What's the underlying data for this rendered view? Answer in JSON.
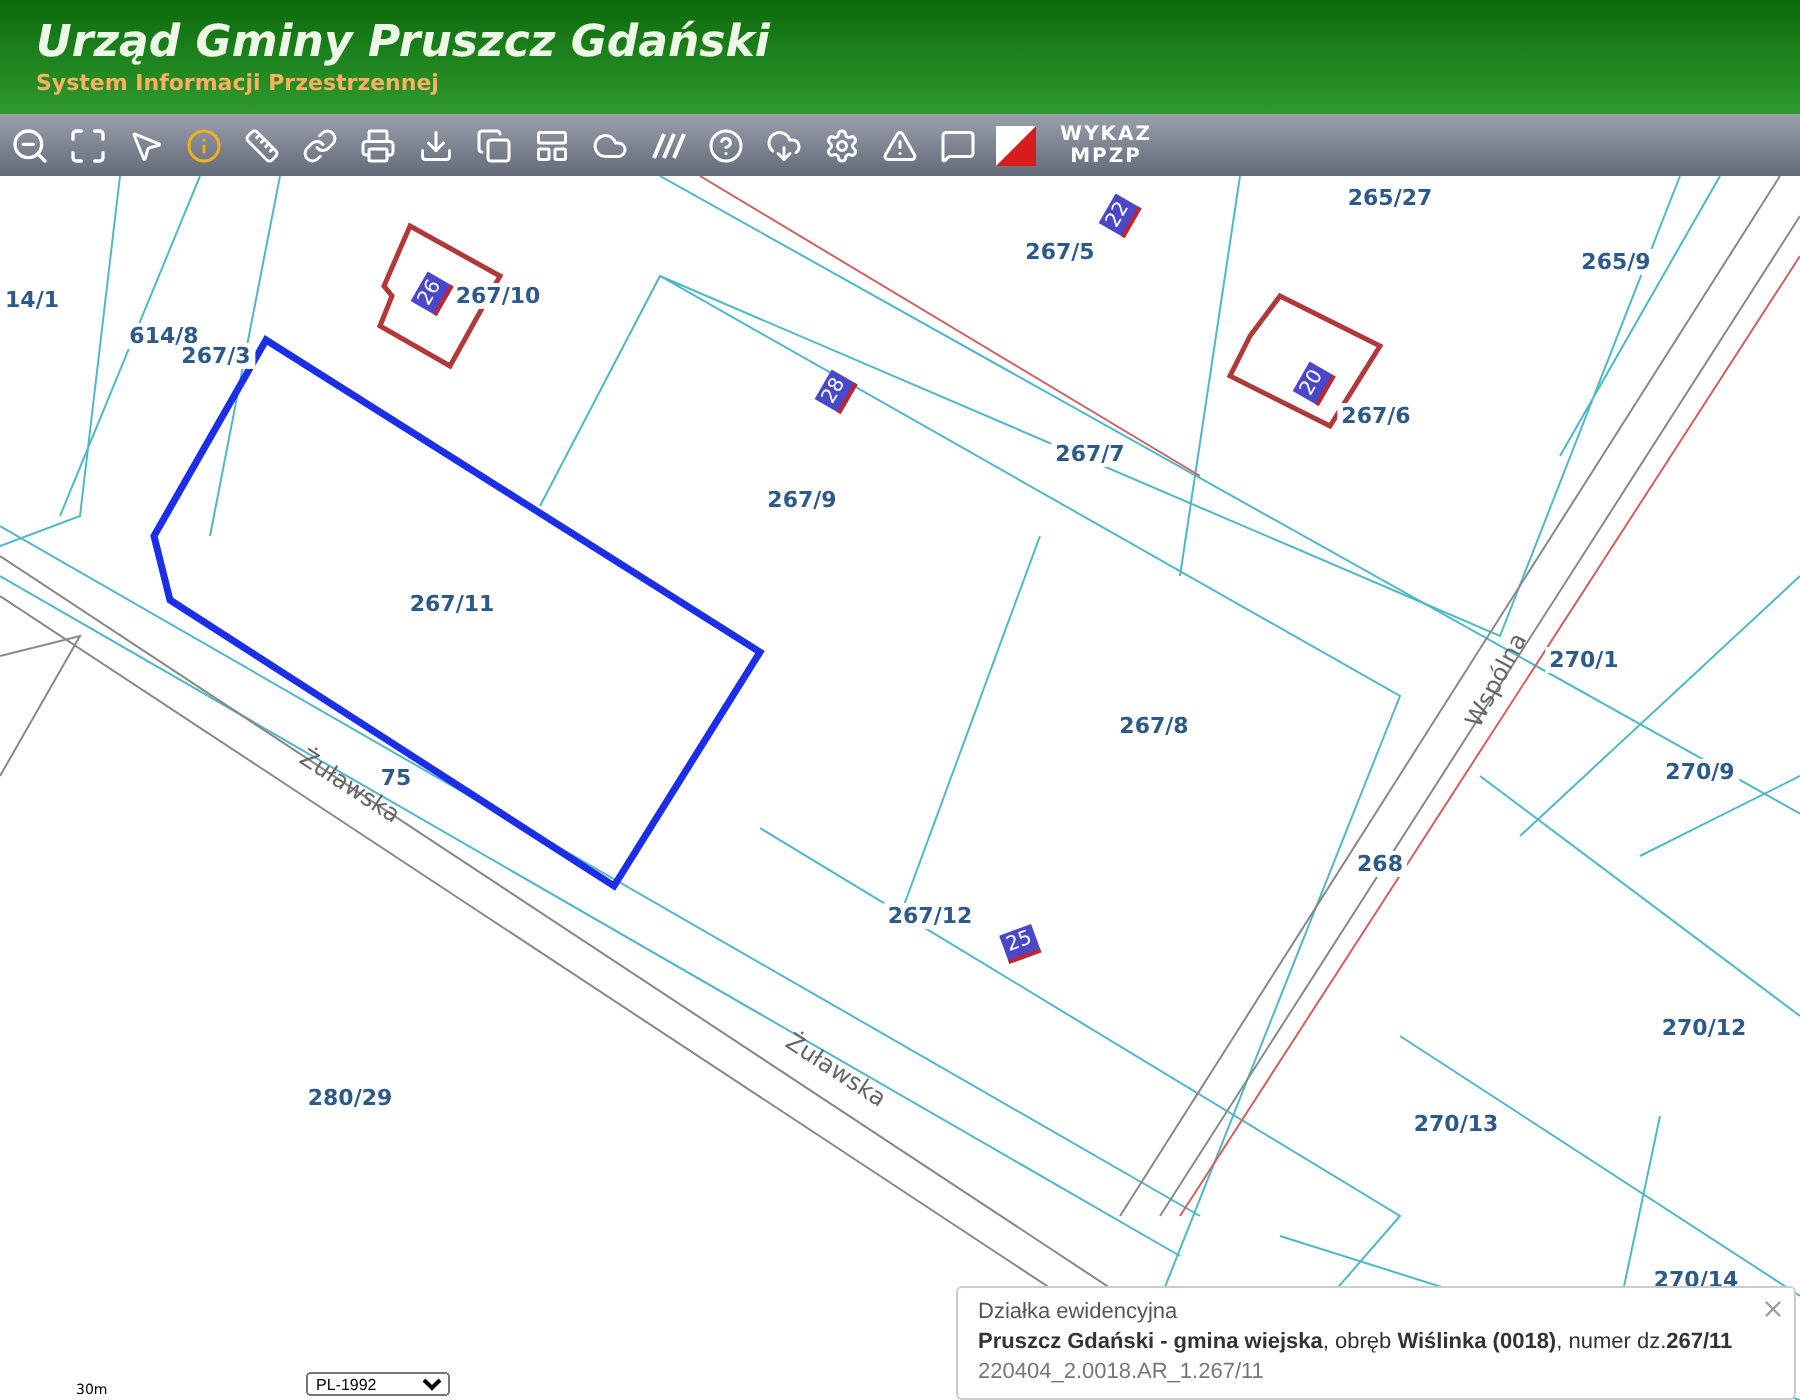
{
  "header": {
    "title": "Urząd Gminy Pruszcz Gdański",
    "subtitle": "System Informacji Przestrzennej"
  },
  "toolbar": {
    "wykaz_button": [
      "WYKAZ",
      "MPZP"
    ]
  },
  "map": {
    "parcel_labels": [
      "14/1",
      "614/8",
      "267/3",
      "267/10",
      "267/5",
      "265/27",
      "265/9",
      "267/6",
      "267/9",
      "267/7",
      "267/11",
      "267/8",
      "270/1",
      "270/9",
      "75",
      "268",
      "267/12",
      "270/12",
      "280/29",
      "270/13",
      "270/14"
    ],
    "house_numbers": [
      "26",
      "28",
      "22",
      "20",
      "25"
    ],
    "street_labels": [
      "Żuławska",
      "Żuławska",
      "Wspólna"
    ],
    "scale": "30m",
    "crs_select": {
      "value": "PL-1992"
    }
  },
  "info_popup": {
    "heading": "Działka ewidencyjna",
    "description": "**Pruszcz Gdański - gmina wiejska**, obręb **Wiślinka (0018)**, numer dz.**267/11**",
    "identifier": "220404_2.0018.AR_1.267/11"
  }
}
